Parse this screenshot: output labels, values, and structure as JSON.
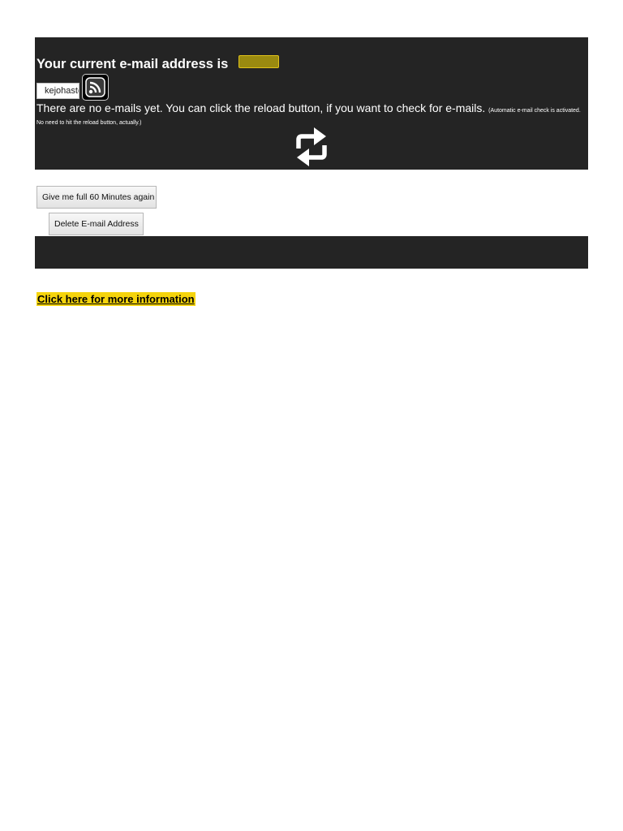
{
  "mailbox": {
    "headline": "Your current e-mail address is",
    "email_value": "kejohastc",
    "status_main": "There are no e-mails yet. You can click the reload button, if you want to check for e-mails.",
    "status_note": "(Automatic e-mail check is activated. No need to hit the reload button, actually.)",
    "icons": {
      "rss": "rss-icon",
      "reload": "reload-icon"
    },
    "colors": {
      "panel": "#242424",
      "address_box": "#9a8a10",
      "link_highlight": "#f5d40c"
    }
  },
  "actions": {
    "extend_label": "Give me full 60 Minutes again",
    "delete_label": "Delete E-mail Address"
  },
  "footer": {
    "more_info_link": "Click here for more information"
  }
}
